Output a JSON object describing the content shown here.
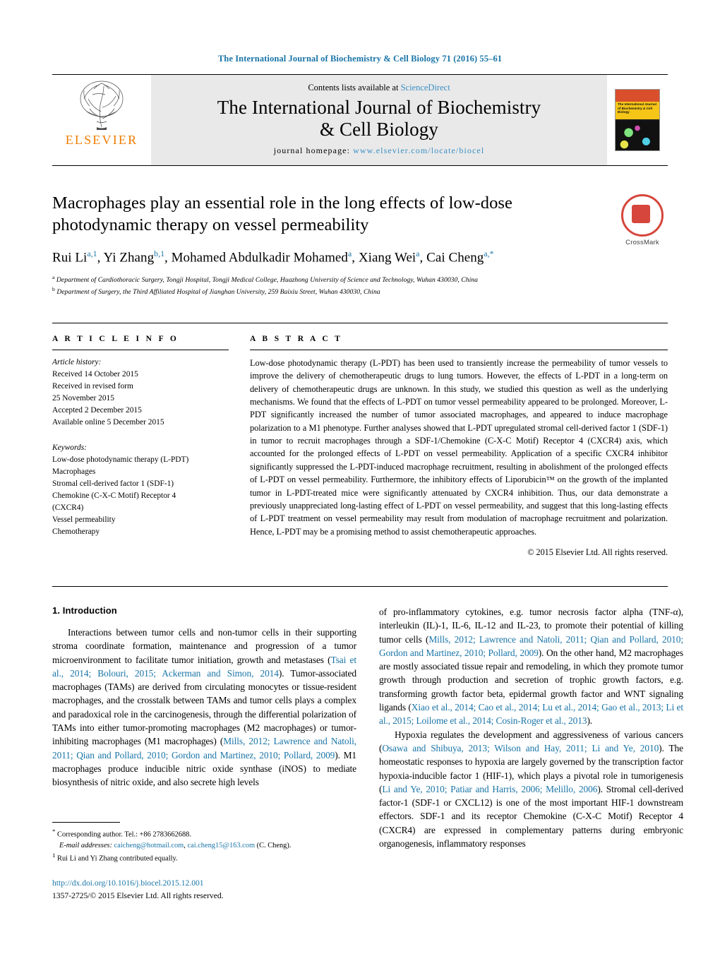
{
  "running_head": "The International Journal of Biochemistry & Cell Biology 71 (2016) 55–61",
  "masthead": {
    "publisher": "ELSEVIER",
    "contents_prefix": "Contents lists available at ",
    "contents_link": "ScienceDirect",
    "journal_title_line1": "The International Journal of Biochemistry",
    "journal_title_line2": "& Cell Biology",
    "homepage_label": "journal homepage: ",
    "homepage_url": "www.elsevier.com/locate/biocel",
    "cover_text": "The International Journal of Biochemistry & Cell Biology"
  },
  "article": {
    "title": "Macrophages play an essential role in the long effects of low-dose photodynamic therapy on vessel permeability",
    "authors_html": "Rui Li<sup class=\"aff\">a,1</sup>, Yi Zhang<sup class=\"aff\">b,1</sup>, Mohamed Abdulkadir Mohamed<sup class=\"aff\">a</sup>, Xiang Wei<sup class=\"aff\">a</sup>, Cai Cheng<sup class=\"aff\">a,*</sup>",
    "affiliation_a": "Department of Cardiothoracic Surgery, Tongji Hospital, Tongji Medical College, Huazhong University of Science and Technology, Wuhan 430030, China",
    "affiliation_b": "Department of Surgery, the Third Affiliated Hospital of Jianghan University, 259 Baixiu Street, Wuhan 430030, China",
    "crossmark_label": "CrossMark"
  },
  "article_info": {
    "heading": "A R T I C L E    I N F O",
    "history_label": "Article history:",
    "history": [
      "Received 14 October 2015",
      "Received in revised form",
      "25 November 2015",
      "Accepted 2 December 2015",
      "Available online 5 December 2015"
    ],
    "keywords_label": "Keywords:",
    "keywords": [
      "Low-dose photodynamic therapy (L-PDT)",
      "Macrophages",
      "Stromal cell-derived factor 1 (SDF-1)",
      "Chemokine (C-X-C Motif) Receptor 4",
      "(CXCR4)",
      "Vessel permeability",
      "Chemotherapy"
    ]
  },
  "abstract": {
    "heading": "A B S T R A C T",
    "text": "Low-dose photodynamic therapy (L-PDT) has been used to transiently increase the permeability of tumor vessels to improve the delivery of chemotherapeutic drugs to lung tumors. However, the effects of L-PDT in a long-term on delivery of chemotherapeutic drugs are unknown. In this study, we studied this question as well as the underlying mechanisms. We found that the effects of L-PDT on tumor vessel permeability appeared to be prolonged. Moreover, L-PDT significantly increased the number of tumor associated macrophages, and appeared to induce macrophage polarization to a M1 phenotype. Further analyses showed that L-PDT upregulated stromal cell-derived factor 1 (SDF-1) in tumor to recruit macrophages through a SDF-1/Chemokine (C-X-C Motif) Receptor 4 (CXCR4) axis, which accounted for the prolonged effects of L-PDT on vessel permeability. Application of a specific CXCR4 inhibitor significantly suppressed the L-PDT-induced macrophage recruitment, resulting in abolishment of the prolonged effects of L-PDT on vessel permeability. Furthermore, the inhibitory effects of Liporubicin™ on the growth of the implanted tumor in L-PDT-treated mice were significantly attenuated by CXCR4 inhibition. Thus, our data demonstrate a previously unappreciated long-lasting effect of L-PDT on vessel permeability, and suggest that this long-lasting effects of L-PDT treatment on vessel permeability may result from modulation of macrophage recruitment and polarization. Hence, L-PDT may be a promising method to assist chemotherapeutic approaches.",
    "copyright": "© 2015 Elsevier Ltd. All rights reserved."
  },
  "body": {
    "section_heading": "1.  Introduction",
    "left_paragraph_1_html": "Interactions between tumor cells and non-tumor cells in their supporting stroma coordinate formation, maintenance and progression of a tumor microenvironment to facilitate tumor initiation, growth and metastases (<span class=\"cite\">Tsai et al., 2014; Bolouri, 2015; Ackerman and Simon, 2014</span>). Tumor-associated macrophages (TAMs) are derived from circulating monocytes or tissue-resident macrophages, and the crosstalk between TAMs and tumor cells plays a complex and paradoxical role in the carcinogenesis, through the differential polarization of TAMs into either tumor-promoting macrophages (M2 macrophages) or tumor-inhibiting macrophages (M1 macrophages) (<span class=\"cite\">Mills, 2012; Lawrence and Natoli, 2011; Qian and Pollard, 2010; Gordon and Martinez, 2010; Pollard, 2009</span>). M1 macrophages produce inducible nitric oxide synthase (iNOS) to mediate biosynthesis of nitric oxide, and also secrete high levels",
    "right_paragraph_1_html": "of pro-inflammatory cytokines, e.g. tumor necrosis factor alpha (TNF-α), interleukin (IL)-1, IL-6, IL-12 and IL-23, to promote their potential of killing tumor cells (<span class=\"cite\">Mills, 2012; Lawrence and Natoli, 2011; Qian and Pollard, 2010; Gordon and Martinez, 2010; Pollard, 2009</span>). On the other hand, M2 macrophages are mostly associated tissue repair and remodeling, in which they promote tumor growth through production and secretion of trophic growth factors, e.g. transforming growth factor beta, epidermal growth factor and WNT signaling ligands (<span class=\"cite\">Xiao et al., 2014; Cao et al., 2014; Lu et al., 2014; Gao et al., 2013; Li et al., 2015; Loilome et al., 2014; Cosin-Roger et al., 2013</span>).",
    "right_paragraph_2_html": "Hypoxia regulates the development and aggressiveness of various cancers (<span class=\"cite\">Osawa and Shibuya, 2013; Wilson and Hay, 2011; Li and Ye, 2010</span>). The homeostatic responses to hypoxia are largely governed by the transcription factor hypoxia-inducible factor 1 (HIF-1), which plays a pivotal role in tumorigenesis (<span class=\"cite\">Li and Ye, 2010; Patiar and Harris, 2006; Melillo, 2006</span>). Stromal cell-derived factor-1 (SDF-1 or CXCL12) is one of the most important HIF-1 downstream effectors. SDF-1 and its receptor Chemokine (C-X-C Motif) Receptor 4 (CXCR4) are expressed in complementary patterns during embryonic organogenesis, inflammatory responses"
  },
  "footnotes": {
    "corresponding_html": "<sup>*</sup> Corresponding author. Tel.: +86 2783662688.",
    "email_html": "<span class=\"lbl\">E-mail addresses:</span> <span class=\"cite\">caicheng@hotmail.com</span>, <span class=\"cite\">cai.cheng15@163.com</span> (C. Cheng).",
    "equal_contrib_html": "<sup>1</sup> Rui Li and Yi Zhang contributed equally.",
    "doi": "http://dx.doi.org/10.1016/j.biocel.2015.12.001",
    "issn_line": "1357-2725/© 2015 Elsevier Ltd. All rights reserved."
  }
}
